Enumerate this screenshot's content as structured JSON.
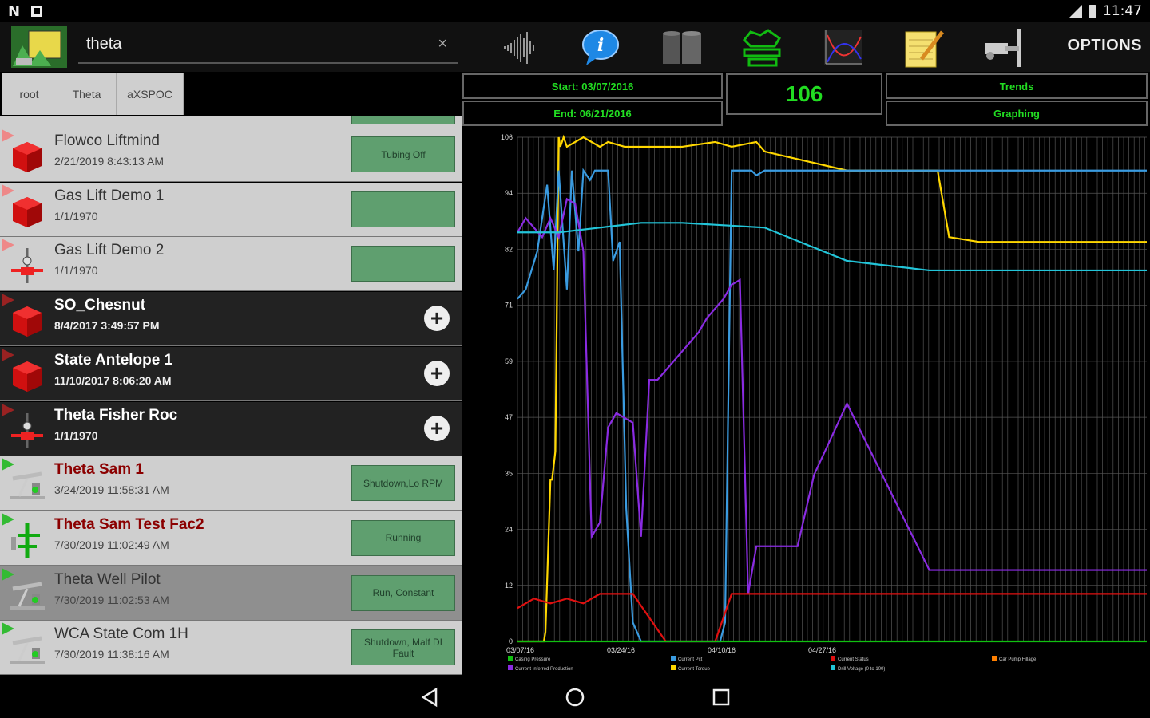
{
  "status_bar": {
    "time": "11:47",
    "left_icons": [
      "N"
    ]
  },
  "toolbar": {
    "search_value": "theta",
    "clear_symbol": "×",
    "options_label": "OPTIONS",
    "icons": [
      "waveform-icon",
      "info-icon",
      "tank-icon",
      "cloud-icon",
      "graph-icon",
      "notepad-icon",
      "pump-icon"
    ]
  },
  "breadcrumb": [
    "root",
    "Theta",
    "aXSPOC"
  ],
  "list": [
    {
      "name": "Flowco Liftmind",
      "date": "2/21/2019 8:43:13 AM",
      "status": "Tubing Off",
      "style": "light",
      "icon": "red-cube",
      "flag": "pink"
    },
    {
      "name": "Gas Lift Demo 1",
      "date": "1/1/1970",
      "status": "",
      "style": "light",
      "icon": "red-cube",
      "flag": "pink"
    },
    {
      "name": "Gas Lift Demo 2",
      "date": "1/1/1970",
      "status": "",
      "style": "light",
      "icon": "valve",
      "flag": "pink"
    },
    {
      "name": "SO_Chesnut",
      "date": "8/4/2017 3:49:57 PM",
      "status": null,
      "style": "dark",
      "icon": "red-cube",
      "flag": "darkred"
    },
    {
      "name": "State Antelope 1",
      "date": "11/10/2017 8:06:20 AM",
      "status": null,
      "style": "dark",
      "icon": "red-cube",
      "flag": "darkred"
    },
    {
      "name": "Theta Fisher Roc",
      "date": "1/1/1970",
      "status": null,
      "style": "dark",
      "icon": "valve",
      "flag": "darkred"
    },
    {
      "name": "Theta Sam 1",
      "date": "3/24/2019 11:58:31 AM",
      "status": "Shutdown,Lo RPM",
      "style": "light",
      "icon": "pumpjack",
      "flag": "green",
      "alarm": true
    },
    {
      "name": "Theta Sam Test Fac2",
      "date": "7/30/2019 11:02:49 AM",
      "status": "Running",
      "style": "light",
      "icon": "green-valve",
      "flag": "green",
      "alarm": true
    },
    {
      "name": "Theta Well Pilot",
      "date": "7/30/2019 11:02:53 AM",
      "status": "Run, Constant",
      "style": "selected",
      "icon": "pumpjack",
      "flag": "green"
    },
    {
      "name": "WCA State Com 1H",
      "date": "7/30/2019 11:38:16 AM",
      "status": "Shutdown, Malf DI Fault",
      "style": "light",
      "icon": "pumpjack",
      "flag": "green"
    }
  ],
  "add_symbol": "+",
  "header": {
    "start_label": "Start:  03/07/2016",
    "end_label": "End:  06/21/2016",
    "count": "106",
    "trends_label": "Trends",
    "graphing_label": "Graphing"
  },
  "chart_data": {
    "type": "line",
    "ylim": [
      0,
      106
    ],
    "yticks": [
      "106",
      "94",
      "82",
      "71",
      "59",
      "47",
      "35",
      "24",
      "12",
      "0"
    ],
    "x_tick_labels": [
      "03/07/16",
      "03/24/16",
      "04/10/16",
      "04/27/16"
    ],
    "series": [
      {
        "color": "#ffd700",
        "x": [
          0,
          0.16,
          0.17,
          0.2,
          0.21,
          0.23,
          0.25,
          0.26,
          0.28,
          0.3,
          0.4,
          0.5,
          0.55,
          0.65,
          0.76,
          1.0,
          1.2,
          1.3,
          1.45,
          1.5,
          2.0,
          2.55,
          2.62,
          2.8,
          3.2,
          3.5,
          3.82
        ],
        "y": [
          0,
          0,
          2,
          34,
          34,
          40,
          106,
          104,
          106,
          104,
          106,
          104,
          105,
          104,
          104,
          104,
          105,
          104,
          105,
          103,
          99,
          99,
          85,
          84,
          84,
          84,
          84
        ]
      },
      {
        "color": "#3a9be0",
        "x": [
          0,
          0.05,
          0.12,
          0.18,
          0.22,
          0.25,
          0.3,
          0.33,
          0.37,
          0.4,
          0.44,
          0.47,
          0.5,
          0.55,
          0.58,
          0.62,
          0.66,
          0.7,
          0.75,
          0.8,
          0.85,
          0.9,
          0.95,
          1.0,
          1.1,
          1.2,
          1.23,
          1.26,
          1.3,
          1.35,
          1.38,
          1.42,
          1.45,
          1.5,
          1.6,
          1.7,
          2.0,
          2.5,
          3.0,
          3.5,
          3.82
        ],
        "y": [
          72,
          74,
          82,
          96,
          78,
          99,
          74,
          99,
          82,
          99,
          97,
          99,
          99,
          99,
          80,
          84,
          28,
          4,
          0,
          0,
          0,
          0,
          0,
          0,
          0,
          0,
          0,
          4,
          99,
          99,
          99,
          99,
          98,
          99,
          99,
          99,
          99,
          99,
          99,
          99,
          99
        ]
      },
      {
        "color": "#8a2be2",
        "x": [
          0,
          0.05,
          0.1,
          0.15,
          0.2,
          0.25,
          0.3,
          0.35,
          0.4,
          0.45,
          0.5,
          0.55,
          0.6,
          0.65,
          0.7,
          0.75,
          0.8,
          0.85,
          0.9,
          0.95,
          1.0,
          1.05,
          1.1,
          1.15,
          1.2,
          1.25,
          1.3,
          1.35,
          1.4,
          1.45,
          1.5,
          1.6,
          1.7,
          1.8,
          2.0,
          2.5,
          3.0,
          3.5,
          3.82
        ],
        "y": [
          86,
          89,
          87,
          85,
          89,
          85,
          93,
          92,
          82,
          22,
          25,
          45,
          48,
          47,
          46,
          22,
          55,
          55,
          57,
          59,
          61,
          63,
          65,
          68,
          70,
          72,
          75,
          76,
          10,
          20,
          20,
          20,
          20,
          35,
          50,
          15,
          15,
          15,
          15
        ]
      },
      {
        "color": "#22c5d9",
        "x": [
          0,
          0.25,
          0.5,
          0.75,
          1.0,
          1.5,
          2.0,
          2.5,
          3.0,
          3.5,
          3.82
        ],
        "y": [
          86,
          86,
          87,
          88,
          88,
          87,
          80,
          78,
          78,
          78,
          78
        ]
      },
      {
        "color": "#e01010",
        "x": [
          0,
          0.1,
          0.2,
          0.3,
          0.4,
          0.5,
          0.6,
          0.7,
          0.8,
          0.9,
          1.0,
          1.1,
          1.2,
          1.3,
          1.5,
          2.0,
          2.5,
          3.0,
          3.5,
          3.82
        ],
        "y": [
          7,
          9,
          8,
          9,
          8,
          10,
          10,
          10,
          5,
          0,
          0,
          0,
          0,
          10,
          10,
          10,
          10,
          10,
          10,
          10
        ]
      },
      {
        "color": "#10c010",
        "x": [
          0,
          3.82
        ],
        "y": [
          0,
          0
        ]
      }
    ],
    "legend_entries": [
      {
        "color": "#10c010",
        "label": "Casing Pressure"
      },
      {
        "color": "#8a2be2",
        "label": "Current Inferred Production"
      },
      {
        "color": "#3a9be0",
        "label": "Current Pct"
      },
      {
        "color": "#ffd700",
        "label": "Current Torque"
      },
      {
        "color": "#e01010",
        "label": "Current Status"
      },
      {
        "color": "#22c5d9",
        "label": "Drill Voltage (0 to 100)"
      },
      {
        "color": "#ff7f00",
        "label": "Car Pump Fillage"
      }
    ]
  }
}
